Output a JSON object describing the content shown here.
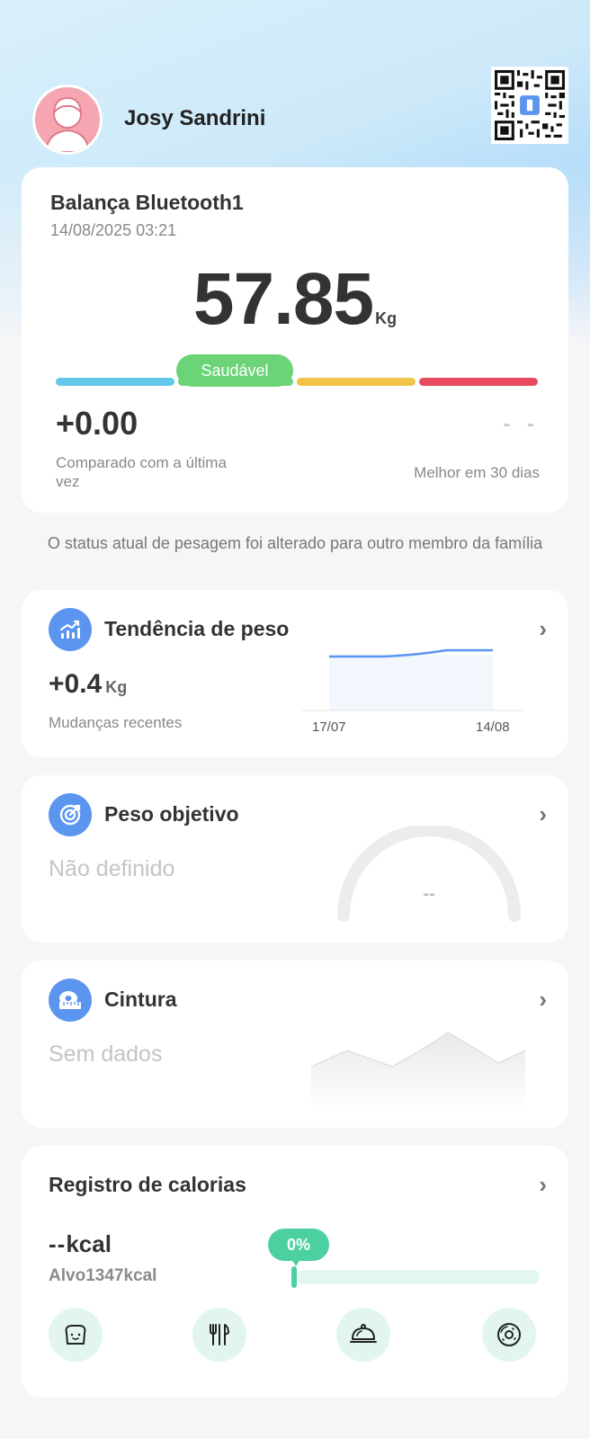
{
  "user": {
    "name": "Josy Sandrini"
  },
  "scale": {
    "device_name": "Balança Bluetooth1",
    "date": "14/08/2025 03:21",
    "weight": "57.85",
    "unit": "Kg",
    "status": "Saudável",
    "diff_value": "+0.00",
    "diff_label": "Comparado com a última vez",
    "best_value": "- -",
    "best_label": "Melhor em 30 dias"
  },
  "notice": "O status atual de pesagem foi alterado para outro membro da família",
  "trend": {
    "title": "Tendência de peso",
    "value": "+0.4",
    "unit": "Kg",
    "subtitle": "Mudanças recentes",
    "x_start": "17/07",
    "x_end": "14/08"
  },
  "goal": {
    "title": "Peso objetivo",
    "status": "Não definido",
    "gauge_value": "--"
  },
  "waist": {
    "title": "Cintura",
    "status": "Sem dados"
  },
  "calories": {
    "title": "Registro de calorias",
    "value": "--",
    "unit": "kcal",
    "target_label": "Alvo",
    "target_value": "1347",
    "target_unit": "kcal",
    "percent": "0%",
    "progress": 0
  },
  "colors": {
    "underweight": "#63c8ea",
    "healthy": "#6bd477",
    "overweight": "#f1c347",
    "obese": "#e84a5f",
    "accent": "#5b95f0",
    "calorie_accent": "#4dd0a0"
  },
  "icons": {
    "trend": "trend-chart-icon",
    "goal": "target-icon",
    "waist": "tape-measure-icon",
    "meals": [
      "bread-icon",
      "utensils-icon",
      "cloche-icon",
      "donut-icon"
    ]
  }
}
